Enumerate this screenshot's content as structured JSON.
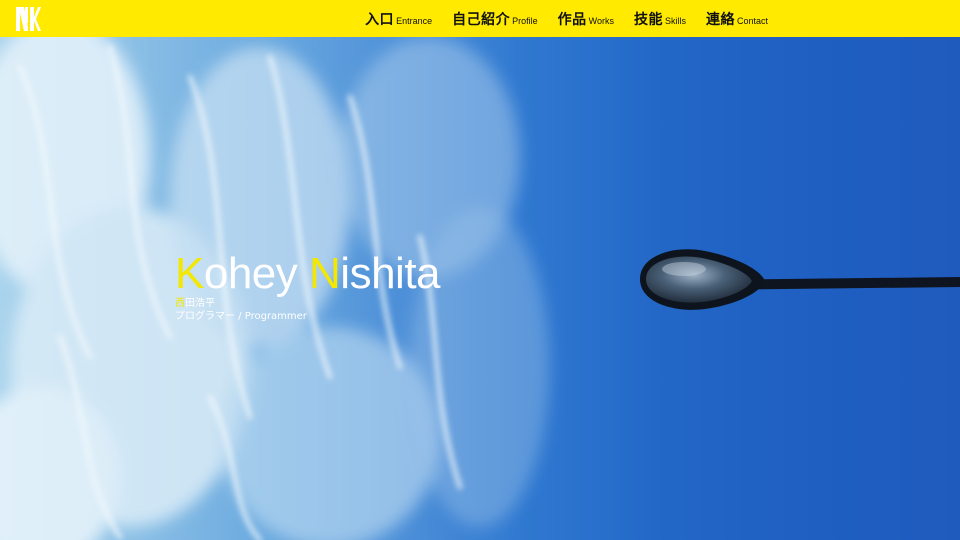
{
  "header": {
    "logo_icon": "nk-logo-icon",
    "nav": [
      {
        "jp": "入口",
        "en": "Entrance"
      },
      {
        "jp": "自己紹介",
        "en": "Profile"
      },
      {
        "jp": "作品",
        "en": "Works"
      },
      {
        "jp": "技能",
        "en": "Skills"
      },
      {
        "jp": "連絡",
        "en": "Contact"
      }
    ],
    "background_color": "#ffea00"
  },
  "hero": {
    "name_first_initial": "K",
    "name_first_rest": "ohey",
    "name_last_initial": "N",
    "name_last_rest": "ishita",
    "jp_name_first_char": "西",
    "jp_name_rest": "田浩平",
    "role": "プログラマー / Programmer",
    "accent_color": "#f4e700",
    "image_icon": "street-lamp-sky-image"
  }
}
